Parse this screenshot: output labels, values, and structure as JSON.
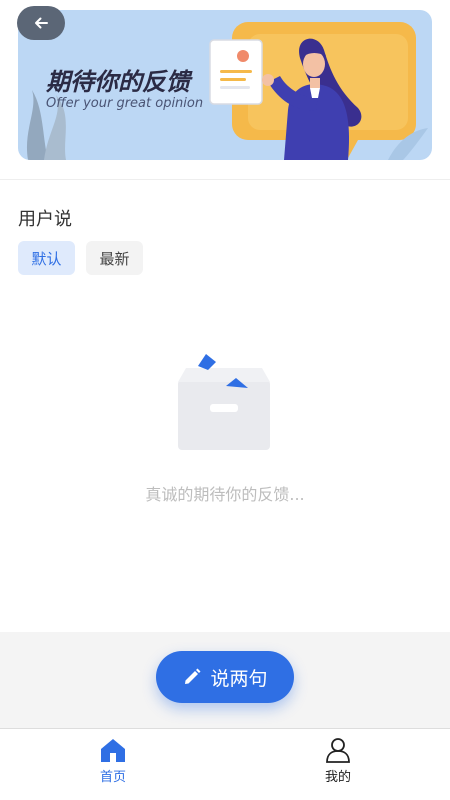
{
  "banner": {
    "title": "期待你的反馈",
    "subtitle": "Offer your great opinion"
  },
  "section": {
    "title": "用户说"
  },
  "tabs": [
    {
      "label": "默认",
      "active": true
    },
    {
      "label": "最新",
      "active": false
    }
  ],
  "empty_state": {
    "text": "真诚的期待你的反馈..."
  },
  "action": {
    "say_label": "说两句"
  },
  "tabbar": {
    "items": [
      {
        "label": "首页",
        "icon": "home-icon",
        "active": true
      },
      {
        "label": "我的",
        "icon": "user-icon",
        "active": false
      }
    ]
  },
  "colors": {
    "accent": "#2f6fe4",
    "banner_bg": "#bcd7f4",
    "empty_text": "#bdbdbd"
  }
}
